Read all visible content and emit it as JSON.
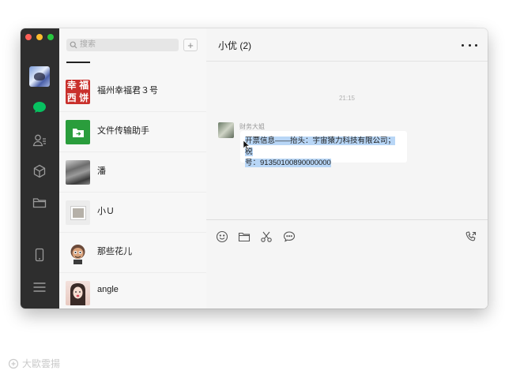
{
  "window": {
    "traffic_lights": [
      "close",
      "minimize",
      "zoom"
    ],
    "colors": {
      "close": "#fe5f57",
      "minimize": "#febc2e",
      "zoom": "#28c840",
      "sidebar_bg": "#2e2e2e",
      "accent_green": "#07c160"
    }
  },
  "sidebar": {
    "icons": [
      "avatar",
      "chat-bubble-icon",
      "contacts-icon",
      "cube-icon",
      "folder-icon",
      "phone-icon",
      "menu-icon"
    ],
    "active": "chat-bubble-icon"
  },
  "search": {
    "placeholder": "搜索"
  },
  "add_button": {
    "label": "+"
  },
  "contacts": [
    {
      "name": "福州幸福君３号",
      "avatar_text": [
        "幸",
        "福",
        "西",
        "饼"
      ]
    },
    {
      "name": "文件传输助手"
    },
    {
      "name": "潘"
    },
    {
      "name": "小Ｕ"
    },
    {
      "name": "那些花儿"
    },
    {
      "name": "angle"
    }
  ],
  "chat": {
    "title": "小优 (2)",
    "timestamp": "21:15",
    "message": {
      "sender": "财务大姐",
      "line1": "开票信息——抬头：宇宙猿力科技有限公司；税",
      "line2_prefix": "号：",
      "line2_number": "91350100890000000",
      "line2_full": "号：91350100890000000"
    }
  },
  "composer": {
    "tools": [
      "emoji-icon",
      "folder-icon",
      "scissors-icon",
      "chat-bubble-icon"
    ],
    "right_tool": "phone-icon"
  },
  "watermark": {
    "text": "大歐雲揚"
  }
}
